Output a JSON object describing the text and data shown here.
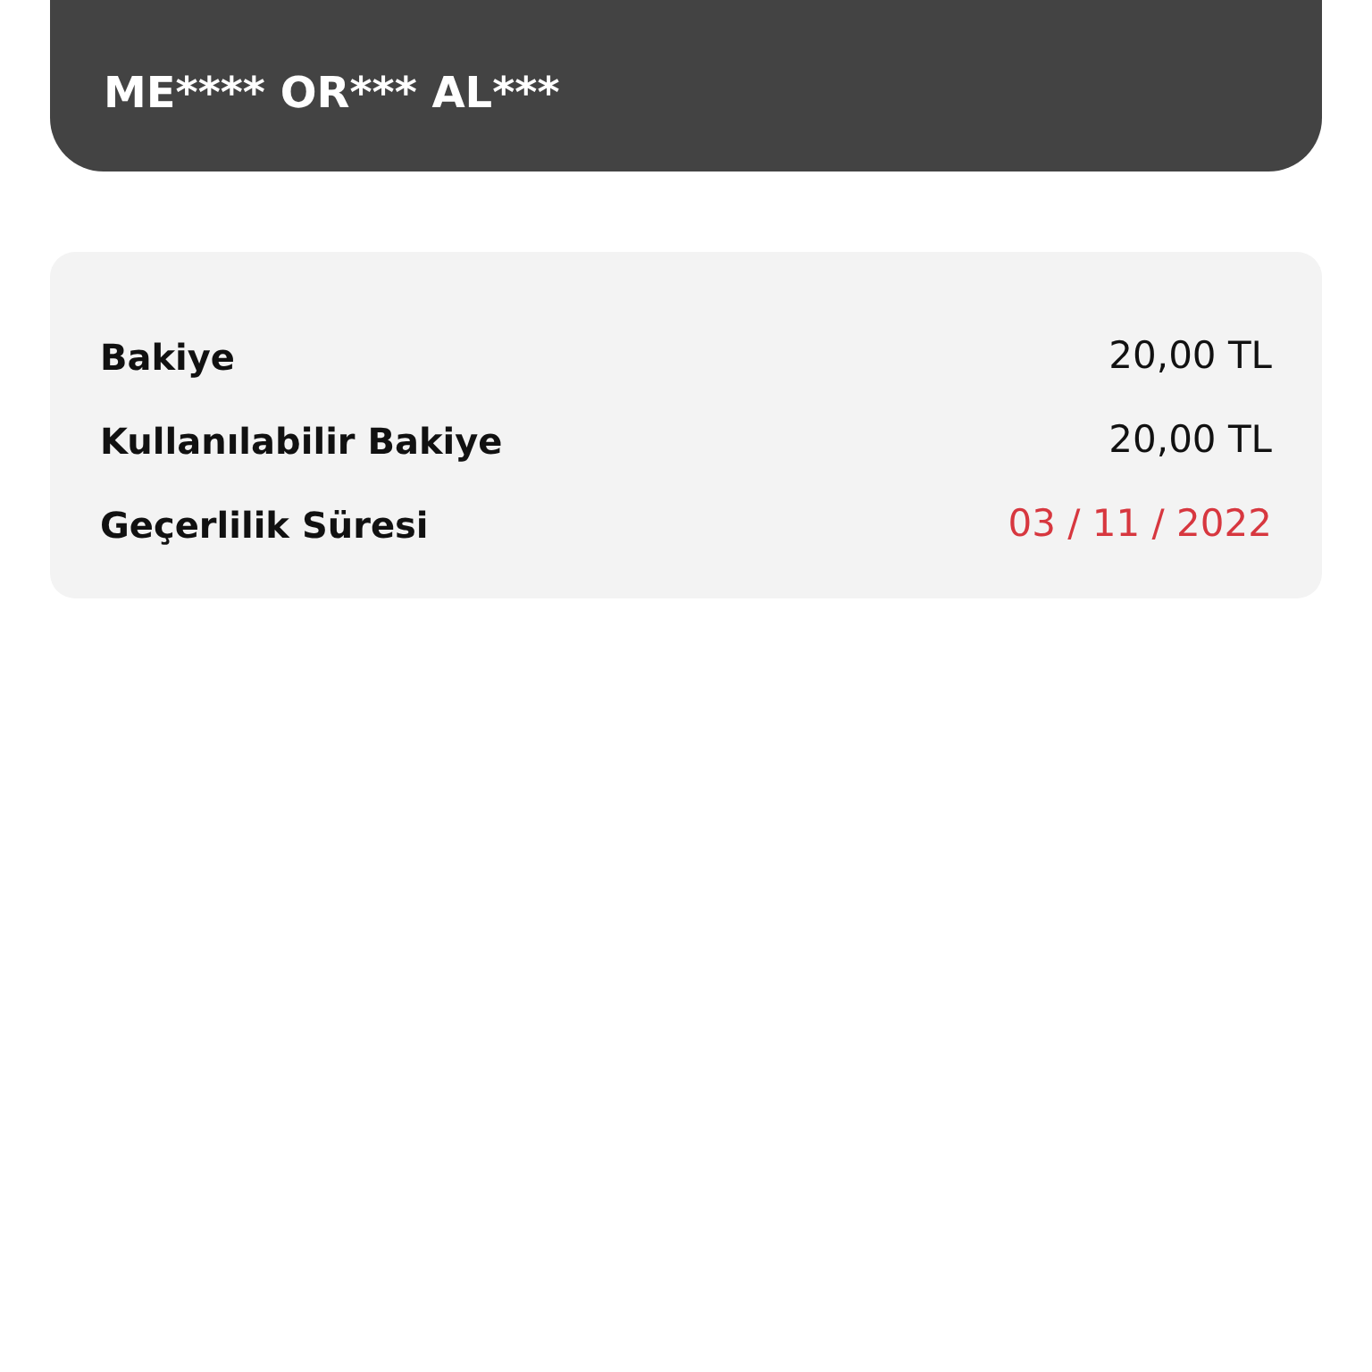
{
  "card": {
    "holder_name": "ME**** OR*** AL***"
  },
  "details": [
    {
      "label": "Bakiye",
      "value": "20,00 TL",
      "color": "#111111"
    },
    {
      "label": "Kullanılabilir Bakiye",
      "value": "20,00 TL",
      "color": "#111111"
    },
    {
      "label": "Geçerlilik Süresi",
      "value": "03 / 11 / 2022",
      "color": "#d7373f"
    }
  ]
}
